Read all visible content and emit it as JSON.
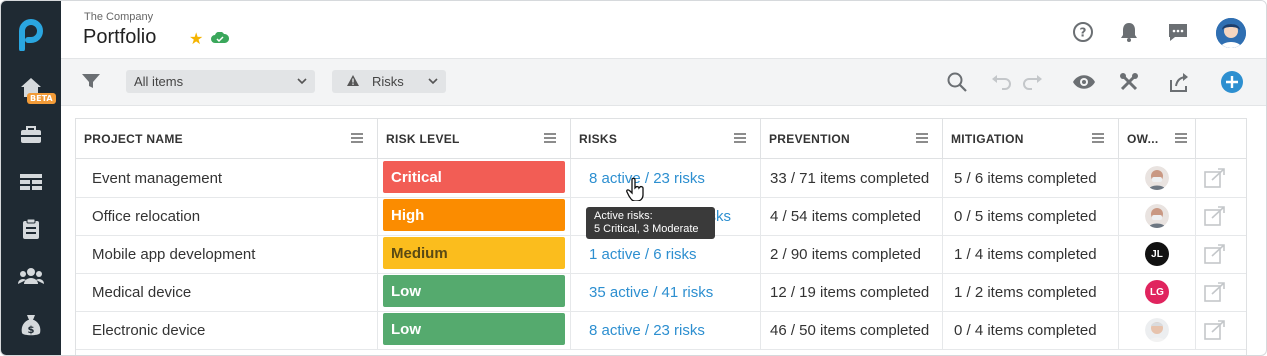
{
  "header": {
    "company": "The Company",
    "title": "Portfolio"
  },
  "sidebar": {
    "badge": "BETA",
    "items": [
      "home-icon",
      "briefcase-icon",
      "table-icon",
      "clipboard-icon",
      "team-icon",
      "money-bag-icon"
    ]
  },
  "toolbar": {
    "view_select": "All items",
    "risks_select": "Risks"
  },
  "columns": [
    "PROJECT NAME",
    "RISK LEVEL",
    "RISKS",
    "PREVENTION",
    "MITIGATION",
    "OW..."
  ],
  "rows": [
    {
      "project": "Event management",
      "risk": "Critical",
      "risk_color": "#f25d55",
      "risks": "8 active / 23 risks",
      "prevention": "33 / 71 items completed",
      "mitigation": "5 / 6 items completed",
      "owner": "photo"
    },
    {
      "project": "Office relocation",
      "risk": "High",
      "risk_color": "#fb8c00",
      "risks": "145 risks",
      "prevention": "4 / 54 items completed",
      "mitigation": "0 / 5 items completed",
      "owner": "photo"
    },
    {
      "project": "Mobile app development",
      "risk": "Medium",
      "risk_color": "#fbbd1d",
      "risks": "1 active / 6 risks",
      "prevention": "2 / 90 items completed",
      "mitigation": "1 / 4 items completed",
      "owner": "JL"
    },
    {
      "project": "Medical device",
      "risk": "Low",
      "risk_color": "#55aa6e",
      "risks": "35 active / 41 risks",
      "prevention": "12 / 19 items completed",
      "mitigation": "1 / 2 items completed",
      "owner": "LG"
    },
    {
      "project": "Electronic device",
      "risk": "Low",
      "risk_color": "#55aa6e",
      "risks": "8 active / 23 risks",
      "prevention": "46 / 50 items completed",
      "mitigation": "0 / 4 items completed",
      "owner": "photo"
    }
  ],
  "tooltip": {
    "line1": "Active risks:",
    "line2": "5 Critical, 3 Moderate"
  }
}
